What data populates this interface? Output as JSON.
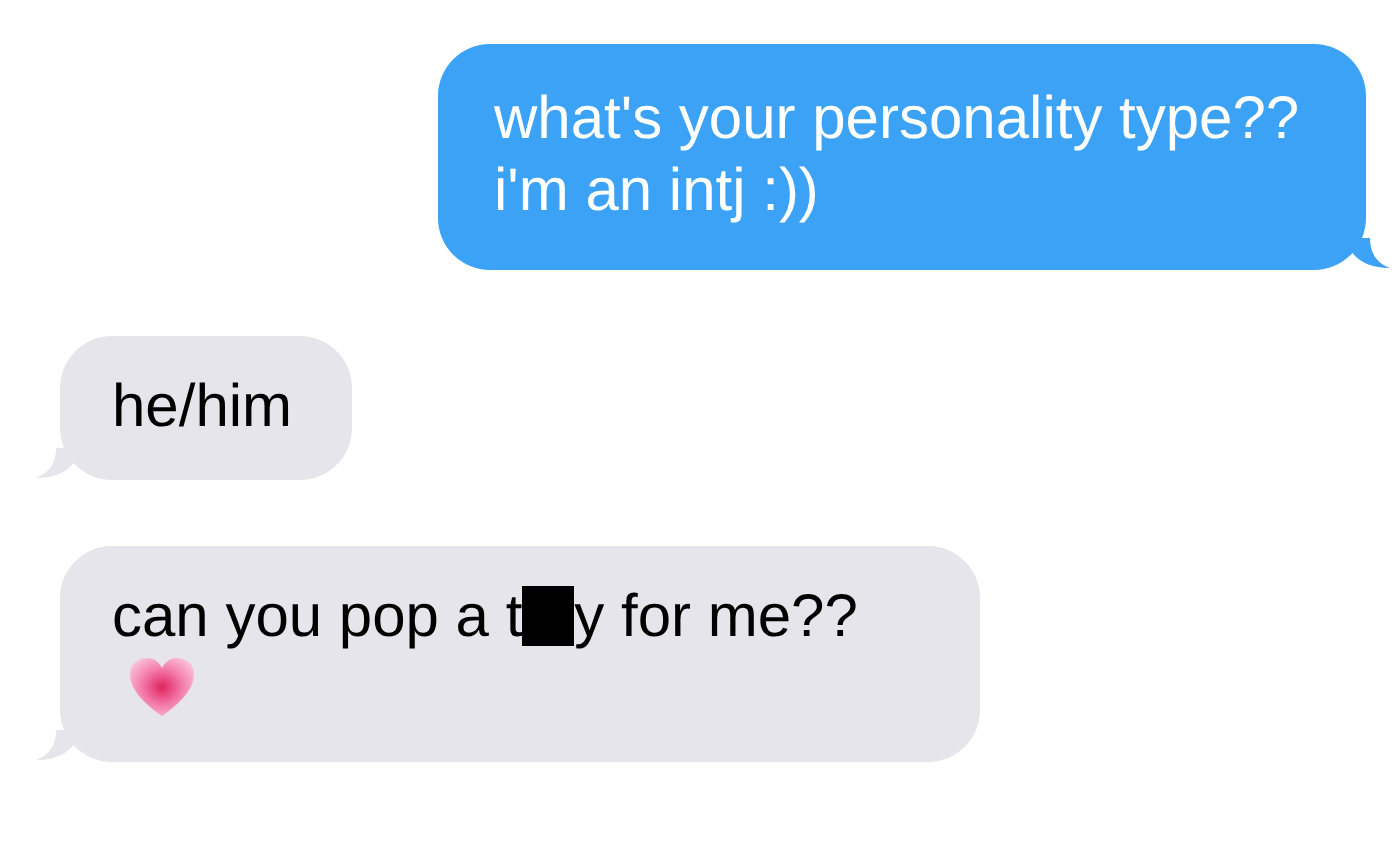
{
  "messages": [
    {
      "kind": "sent",
      "text_before": "what's your personality type?? i'm an intj :))"
    },
    {
      "kind": "received",
      "text_before": "he/him"
    },
    {
      "kind": "received",
      "text_before": "can you pop a t",
      "redacted": true,
      "text_after": "y for me??",
      "heart": true
    }
  ]
}
